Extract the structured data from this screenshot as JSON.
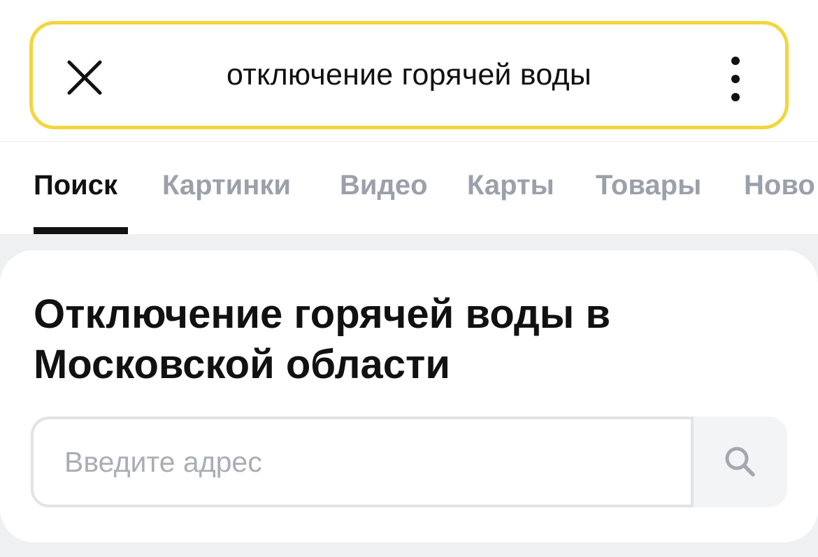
{
  "search": {
    "query": "отключение горячей воды",
    "close_icon": "close-icon",
    "more_icon": "more-vertical-icon",
    "border_color": "#f2d63c"
  },
  "tabs": [
    {
      "label": "Поиск",
      "active": true
    },
    {
      "label": "Картинки",
      "active": false
    },
    {
      "label": "Видео",
      "active": false
    },
    {
      "label": "Карты",
      "active": false
    },
    {
      "label": "Товары",
      "active": false
    },
    {
      "label": "Ново",
      "active": false
    }
  ],
  "card": {
    "title": "Отключение горячей воды в Московской области",
    "address_placeholder": "Введите адрес",
    "search_icon": "search-icon"
  }
}
